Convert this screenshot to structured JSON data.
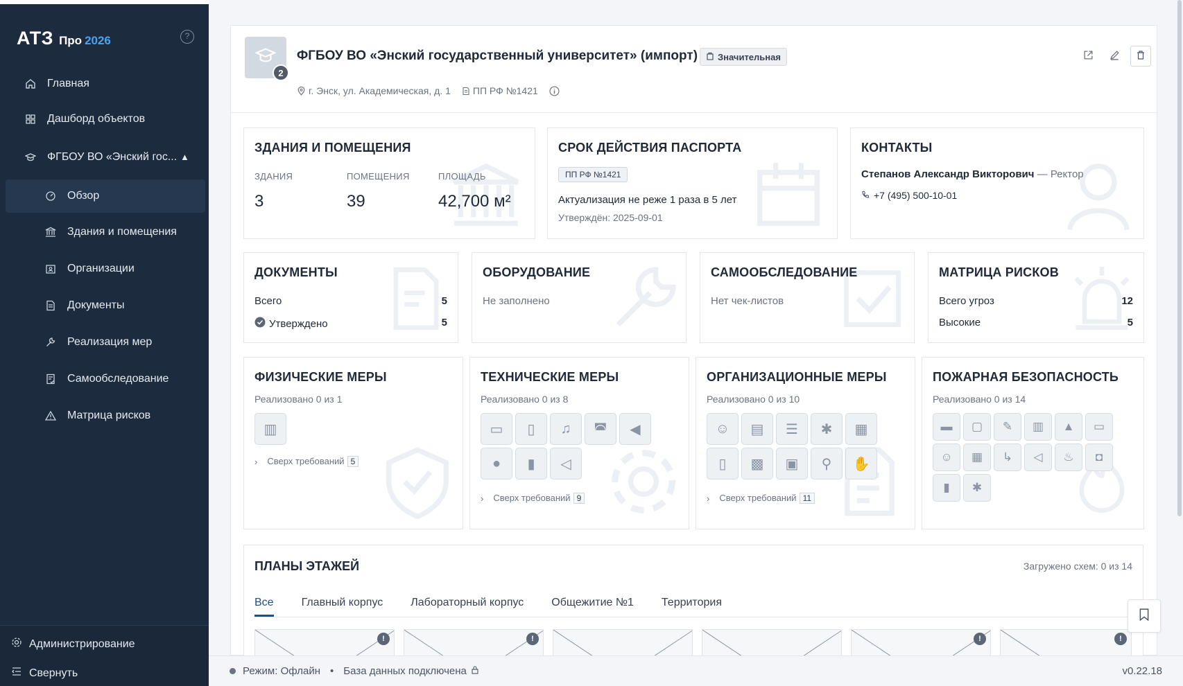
{
  "brand": {
    "logo": "АТЗ",
    "edition": "Про",
    "year": "2026"
  },
  "sidebar": {
    "help_icon": "question-circle-icon",
    "items": [
      {
        "label": "Главная",
        "icon": "home-icon"
      },
      {
        "label": "Дашборд объектов",
        "icon": "grid-icon"
      },
      {
        "label": "ФГБОУ ВО «Энский гос...",
        "icon": "graduation-cap-icon"
      }
    ],
    "sub_items": [
      {
        "label": "Обзор",
        "icon": "gauge-icon"
      },
      {
        "label": "Здания и помещения",
        "icon": "bank-icon"
      },
      {
        "label": "Организации",
        "icon": "id-card-icon"
      },
      {
        "label": "Документы",
        "icon": "document-icon"
      },
      {
        "label": "Реализация мер",
        "icon": "wrench-icon"
      },
      {
        "label": "Самообследование",
        "icon": "checklist-icon"
      },
      {
        "label": "Матрица рисков",
        "icon": "warning-icon"
      }
    ],
    "admin_label": "Администрирование",
    "collapse_label": "Свернуть"
  },
  "object": {
    "title": "ФГБОУ ВО «Энский государственный университет» (импорт)",
    "badge": "Значительная",
    "count": "2",
    "address": "г. Энск, ул. Академическая, д. 1",
    "regulation": "ПП РФ №1421"
  },
  "buildings": {
    "title": "Здания и помещения",
    "labels": [
      "ЗДАНИЯ",
      "ПОМЕЩЕНИЯ",
      "ПЛОЩАДЬ"
    ],
    "buildings": "3",
    "rooms": "39",
    "area": "42,700 м²"
  },
  "passport": {
    "title": "Срок действия паспорта",
    "tag": "ПП РФ №1421",
    "period": "Актуализация не реже 1 раза в 5 лет",
    "approved": "Утверждён: 2025-09-01"
  },
  "contacts": {
    "title": "Контакты",
    "name": "Степанов Александр Викторович",
    "role": "— Ректор",
    "phone": "+7 (495) 500-10-01"
  },
  "documents": {
    "title": "Документы",
    "total_label": "Всего",
    "total": "5",
    "approved_label": "Утверждено",
    "approved": "5"
  },
  "equipment": {
    "title": "Оборудование",
    "status": "Не заполнено"
  },
  "self_check": {
    "title": "Самообследование",
    "status": "Нет чек-листов"
  },
  "risks": {
    "title": "Матрица рисков",
    "total_label": "Всего угроз",
    "total": "12",
    "high_label": "Высокие",
    "high": "5"
  },
  "measures": [
    {
      "title": "Физические меры",
      "sub": "Реализовано 0 из 1",
      "beyond": "Сверх требований",
      "beyond_count": "5",
      "icons": [
        "fence-icon"
      ]
    },
    {
      "title": "Технические меры",
      "sub": "Реализовано 0 из 8",
      "beyond": "Сверх требований",
      "beyond_count": "9",
      "icons": [
        "camera-icon",
        "phone-icon",
        "bell-icon",
        "siren-icon",
        "megaphone-icon",
        "bomb-icon",
        "door-icon",
        "loudspeaker-icon"
      ]
    },
    {
      "title": "Организационные меры",
      "sub": "Реализовано 0 из 10",
      "beyond": "Сверх требований",
      "beyond_count": "11",
      "icons": [
        "guard-icon",
        "badge-icon",
        "server-icon",
        "runner-icon",
        "clipboard-icon",
        "page-icon",
        "grid-doc-icon",
        "window-icon",
        "magnifier-icon",
        "hand-icon"
      ]
    },
    {
      "title": "Пожарная безопасность",
      "sub": "Реализовано 0 из 14",
      "beyond": "",
      "beyond_count": "",
      "icons": [
        "truck-icon",
        "panel-icon",
        "note-icon",
        "book-icon",
        "cap-icon",
        "hose-icon",
        "person-icon",
        "map-icon",
        "exit-icon",
        "speaker-icon",
        "fire-icon",
        "extinguisher-icon",
        "pager-icon",
        "evac-icon"
      ]
    }
  ],
  "plans": {
    "title": "Планы этажей",
    "loaded": "Загружено схем: 0 из 14",
    "tabs": [
      "Все",
      "Главный корпус",
      "Лабораторный корпус",
      "Общежитие №1",
      "Территория"
    ],
    "thumb_info": [
      "!",
      "!",
      "",
      "",
      "!",
      "!"
    ]
  },
  "status": {
    "mode": "Режим: Офлайн",
    "db": "База данных подключена",
    "version": "v0.22.18"
  }
}
